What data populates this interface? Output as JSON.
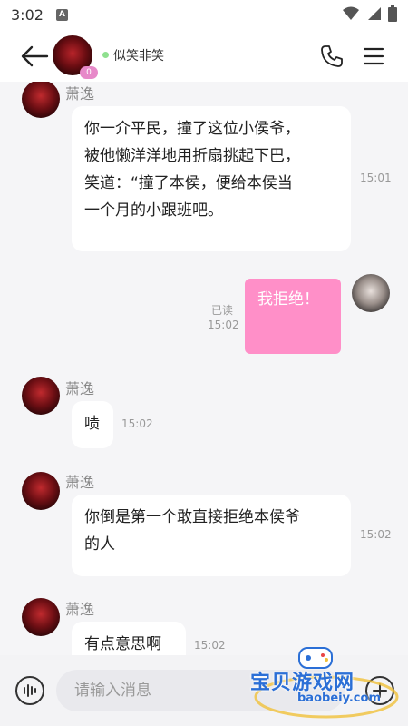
{
  "status_bar": {
    "time": "3:02",
    "app_icon_letter": "A"
  },
  "header": {
    "contact_name": "似笑非笑",
    "gender_badge": "0"
  },
  "messages": [
    {
      "sender": "萧逸",
      "lines": [
        "你一介平民，撞了这位小侯爷，",
        "被他懒洋洋地用折扇挑起下巴，",
        "笑道：“撞了本侯，便给本侯当",
        "一个月的小跟班吧。"
      ],
      "time": "15:01"
    },
    {
      "mine": true,
      "text": "我拒绝！",
      "read": "已读",
      "time": "15:02"
    },
    {
      "sender": "萧逸",
      "text": "啧",
      "time": "15:02"
    },
    {
      "sender": "萧逸",
      "lines": [
        "你倒是第一个敢直接拒绝本侯爷",
        "的人"
      ],
      "time": "15:02"
    },
    {
      "sender": "萧逸",
      "text": "有点意思啊",
      "time": "15:02"
    }
  ],
  "input": {
    "placeholder": "请输入消息"
  },
  "watermark": {
    "text": "宝贝游戏网",
    "url": "baobeiy.com"
  },
  "colors": {
    "my_bubble": "#ff8fc8",
    "online": "#8fe08f",
    "watermark": "#2b6fd6"
  }
}
